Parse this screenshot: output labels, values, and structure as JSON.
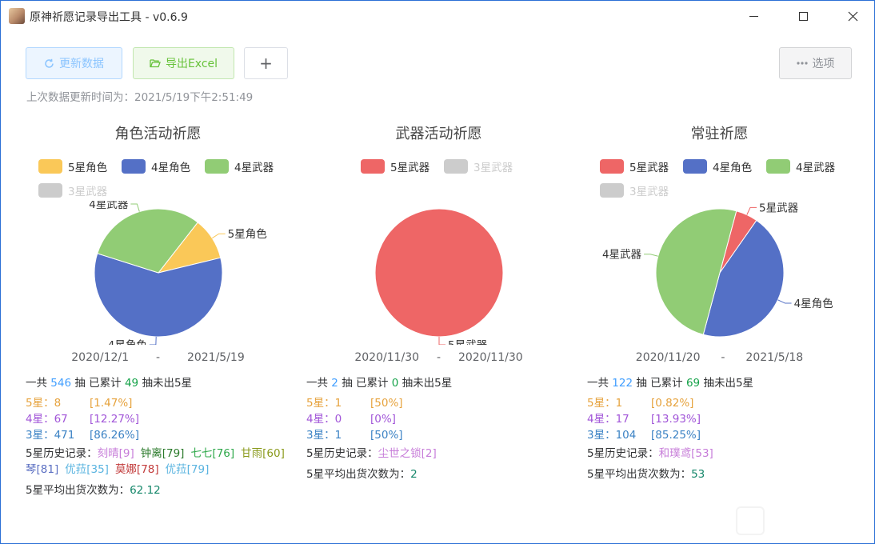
{
  "window": {
    "title": "原神祈愿记录导出工具 - v0.6.9"
  },
  "toolbar": {
    "update_label": "更新数据",
    "export_label": "导出Excel",
    "plus_label": "+",
    "options_label": "选项"
  },
  "last_update": "上次数据更新时间为：2021/5/19下午2:51:49",
  "colors": {
    "five_char": "#fac858",
    "four_char": "#5470c6",
    "four_weapon": "#91cc75",
    "five_weapon": "#ee6666",
    "three_weapon": "#cccccc"
  },
  "labels": {
    "total_prefix": "一共",
    "pulls_unit": "抽",
    "accum_prefix": "已累计",
    "accum_suffix": "抽未出5星",
    "history_label": "5星历史记录：",
    "avg_label": "5星平均出货次数为："
  },
  "panels": [
    {
      "title": "角色活动祈愿",
      "legend": [
        {
          "name": "5星角色",
          "color": "#fac858",
          "active": true
        },
        {
          "name": "4星角色",
          "color": "#5470c6",
          "active": true
        },
        {
          "name": "4星武器",
          "color": "#91cc75",
          "active": true
        },
        {
          "name": "3星武器",
          "color": "#cccccc",
          "active": false
        }
      ],
      "chart_data": {
        "type": "pie",
        "series": [
          {
            "name": "5星角色",
            "value": 8,
            "color": "#fac858"
          },
          {
            "name": "4星角色",
            "value": 44,
            "color": "#5470c6"
          },
          {
            "name": "4星武器",
            "value": 23,
            "color": "#91cc75"
          }
        ]
      },
      "date_start": "2020/12/1",
      "date_sep": "-",
      "date_end": "2021/5/19",
      "total": "546",
      "accum": "49",
      "tiers": [
        {
          "label": "5星：8",
          "pct": "[1.47%]"
        },
        {
          "label": "4星：67",
          "pct": "[12.27%]"
        },
        {
          "label": "3星：471",
          "pct": "[86.26%]"
        }
      ],
      "history": [
        {
          "name": "刻晴[9]",
          "color": "#c77dd9"
        },
        {
          "name": "钟离[79]",
          "color": "#2b7a2b"
        },
        {
          "name": "七七[76]",
          "color": "#2ea84a"
        },
        {
          "name": "甘雨[60]",
          "color": "#8a9a1c"
        },
        {
          "name": "琴[81]",
          "color": "#5b6fc2"
        },
        {
          "name": "优菈[35]",
          "color": "#5ab4e0"
        },
        {
          "name": "莫娜[78]",
          "color": "#c23b3b"
        },
        {
          "name": "优菈[79]",
          "color": "#5ab4e0"
        }
      ],
      "avg": "62.12"
    },
    {
      "title": "武器活动祈愿",
      "legend": [
        {
          "name": "5星武器",
          "color": "#ee6666",
          "active": true
        },
        {
          "name": "3星武器",
          "color": "#cccccc",
          "active": false
        }
      ],
      "chart_data": {
        "type": "pie",
        "series": [
          {
            "name": "5星武器",
            "value": 1,
            "color": "#ee6666"
          }
        ]
      },
      "date_start": "2020/11/30",
      "date_sep": "-",
      "date_end": "2020/11/30",
      "total": "2",
      "accum": "0",
      "tiers": [
        {
          "label": "5星：1",
          "pct": "[50%]"
        },
        {
          "label": "4星：0",
          "pct": "[0%]"
        },
        {
          "label": "3星：1",
          "pct": "[50%]"
        }
      ],
      "history": [
        {
          "name": "尘世之锁[2]",
          "color": "#c77dd9"
        }
      ],
      "avg": "2"
    },
    {
      "title": "常驻祈愿",
      "legend": [
        {
          "name": "5星武器",
          "color": "#ee6666",
          "active": true
        },
        {
          "name": "4星角色",
          "color": "#5470c6",
          "active": true
        },
        {
          "name": "4星武器",
          "color": "#91cc75",
          "active": true
        },
        {
          "name": "3星武器",
          "color": "#cccccc",
          "active": false
        }
      ],
      "chart_data": {
        "type": "pie",
        "series": [
          {
            "name": "5星武器",
            "value": 1,
            "color": "#ee6666"
          },
          {
            "name": "4星角色",
            "value": 8,
            "color": "#5470c6"
          },
          {
            "name": "4星武器",
            "value": 9,
            "color": "#91cc75"
          }
        ]
      },
      "date_start": "2020/11/20",
      "date_sep": "-",
      "date_end": "2021/5/18",
      "total": "122",
      "accum": "69",
      "tiers": [
        {
          "label": "5星：1",
          "pct": "[0.82%]"
        },
        {
          "label": "4星：17",
          "pct": "[13.93%]"
        },
        {
          "label": "3星：104",
          "pct": "[85.25%]"
        }
      ],
      "history": [
        {
          "name": "和璞鸢[53]",
          "color": "#c77dd9"
        }
      ],
      "avg": "53"
    }
  ]
}
